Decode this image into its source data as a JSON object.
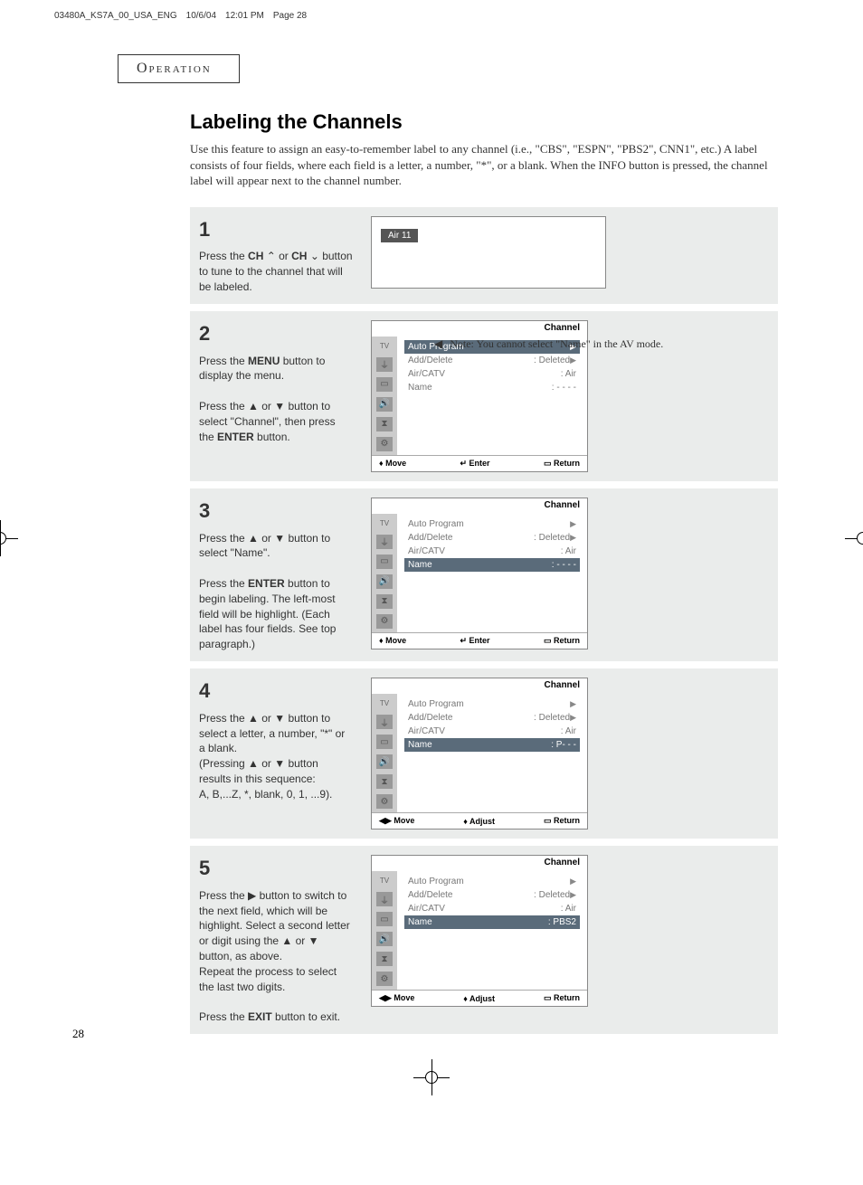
{
  "header": {
    "filename": "03480A_KS7A_00_USA_ENG",
    "date": "10/6/04",
    "time": "12:01 PM",
    "pagelabel": "Page 28"
  },
  "section": "Operation",
  "title": "Labeling the Channels",
  "intro": "Use this feature to assign an easy-to-remember label to any channel (i.e., \"CBS\", \"ESPN\", \"PBS2\", CNN1\", etc.) A label consists of four fields, where each field is a letter, a number, \"*\", or a blank.  When the INFO button is pressed, the channel label will appear next to the channel number.",
  "side_note": "Note: You cannot select \"Name\" in the AV mode.",
  "steps": [
    {
      "num": "1",
      "text_parts": [
        "Press the ",
        "CH",
        " or ",
        "CH",
        " button to tune to the channel that will be labeled."
      ],
      "osd_simple": "Air  11"
    },
    {
      "num": "2",
      "text_parts": [
        "Press the ",
        "MENU",
        " button to display the menu.",
        "",
        "Press the ▲ or ▼ button to select \"Channel\", then press the ",
        "ENTER",
        " button."
      ],
      "osd": {
        "title": "Channel",
        "sel": 0,
        "items": [
          {
            "lbl": "Auto Program",
            "val": "",
            "arrow": "▶"
          },
          {
            "lbl": "Add/Delete",
            "val": ":  Deleted",
            "arrow": "▶"
          },
          {
            "lbl": "Air/CATV",
            "val": ":  Air",
            "arrow": ""
          },
          {
            "lbl": "Name",
            "val": ":  - - - -",
            "arrow": ""
          }
        ],
        "footer": [
          "Move",
          "Enter",
          "Return"
        ],
        "footer_icons": [
          "♦",
          "↵",
          "▭"
        ]
      }
    },
    {
      "num": "3",
      "text_parts": [
        "Press the ▲ or ▼ button to select \"Name\".",
        "",
        "Press the ",
        "ENTER",
        " button to begin labeling. The left-most field will be highlight. (Each label has four fields. See top paragraph.)"
      ],
      "osd": {
        "title": "Channel",
        "sel": 3,
        "items": [
          {
            "lbl": "Auto Program",
            "val": "",
            "arrow": "▶"
          },
          {
            "lbl": "Add/Delete",
            "val": ":  Deleted",
            "arrow": "▶"
          },
          {
            "lbl": "Air/CATV",
            "val": ":  Air",
            "arrow": ""
          },
          {
            "lbl": "Name",
            "val": ":  - - - -",
            "arrow": ""
          }
        ],
        "footer": [
          "Move",
          "Enter",
          "Return"
        ],
        "footer_icons": [
          "♦",
          "↵",
          "▭"
        ]
      }
    },
    {
      "num": "4",
      "text_parts": [
        "Press the ▲ or ▼ button to select a letter, a number, \"*\" or a blank.",
        "(Pressing ▲ or ▼ button results in this sequence:",
        "A, B,...Z,  *, blank, 0, 1, ...9)."
      ],
      "osd": {
        "title": "Channel",
        "sel": 3,
        "items": [
          {
            "lbl": "Auto Program",
            "val": "",
            "arrow": "▶"
          },
          {
            "lbl": "Add/Delete",
            "val": ":  Deleted",
            "arrow": "▶"
          },
          {
            "lbl": "Air/CATV",
            "val": ":  Air",
            "arrow": ""
          },
          {
            "lbl": "Name",
            "val": ":  P- - -",
            "arrow": ""
          }
        ],
        "footer": [
          "Move",
          "Adjust",
          "Return"
        ],
        "footer_icons": [
          "◀▶",
          "♦",
          "▭"
        ]
      }
    },
    {
      "num": "5",
      "text_parts": [
        "Press the ▶ button to switch to the next field, which will be highlight. Select a second letter or digit using the ▲ or ▼ button, as above.",
        "Repeat the process to select the last two digits.",
        "",
        "Press the ",
        "EXIT",
        " button to exit."
      ],
      "osd": {
        "title": "Channel",
        "sel": 3,
        "items": [
          {
            "lbl": "Auto Program",
            "val": "",
            "arrow": "▶"
          },
          {
            "lbl": "Add/Delete",
            "val": ":  Deleted",
            "arrow": "▶"
          },
          {
            "lbl": "Air/CATV",
            "val": ":  Air",
            "arrow": ""
          },
          {
            "lbl": "Name",
            "val": ":  PBS2",
            "arrow": ""
          }
        ],
        "footer": [
          "Move",
          "Adjust",
          "Return"
        ],
        "footer_icons": [
          "◀▶",
          "♦",
          "▭"
        ]
      }
    }
  ],
  "osd_sidebar_top": "TV",
  "page_number": "28"
}
